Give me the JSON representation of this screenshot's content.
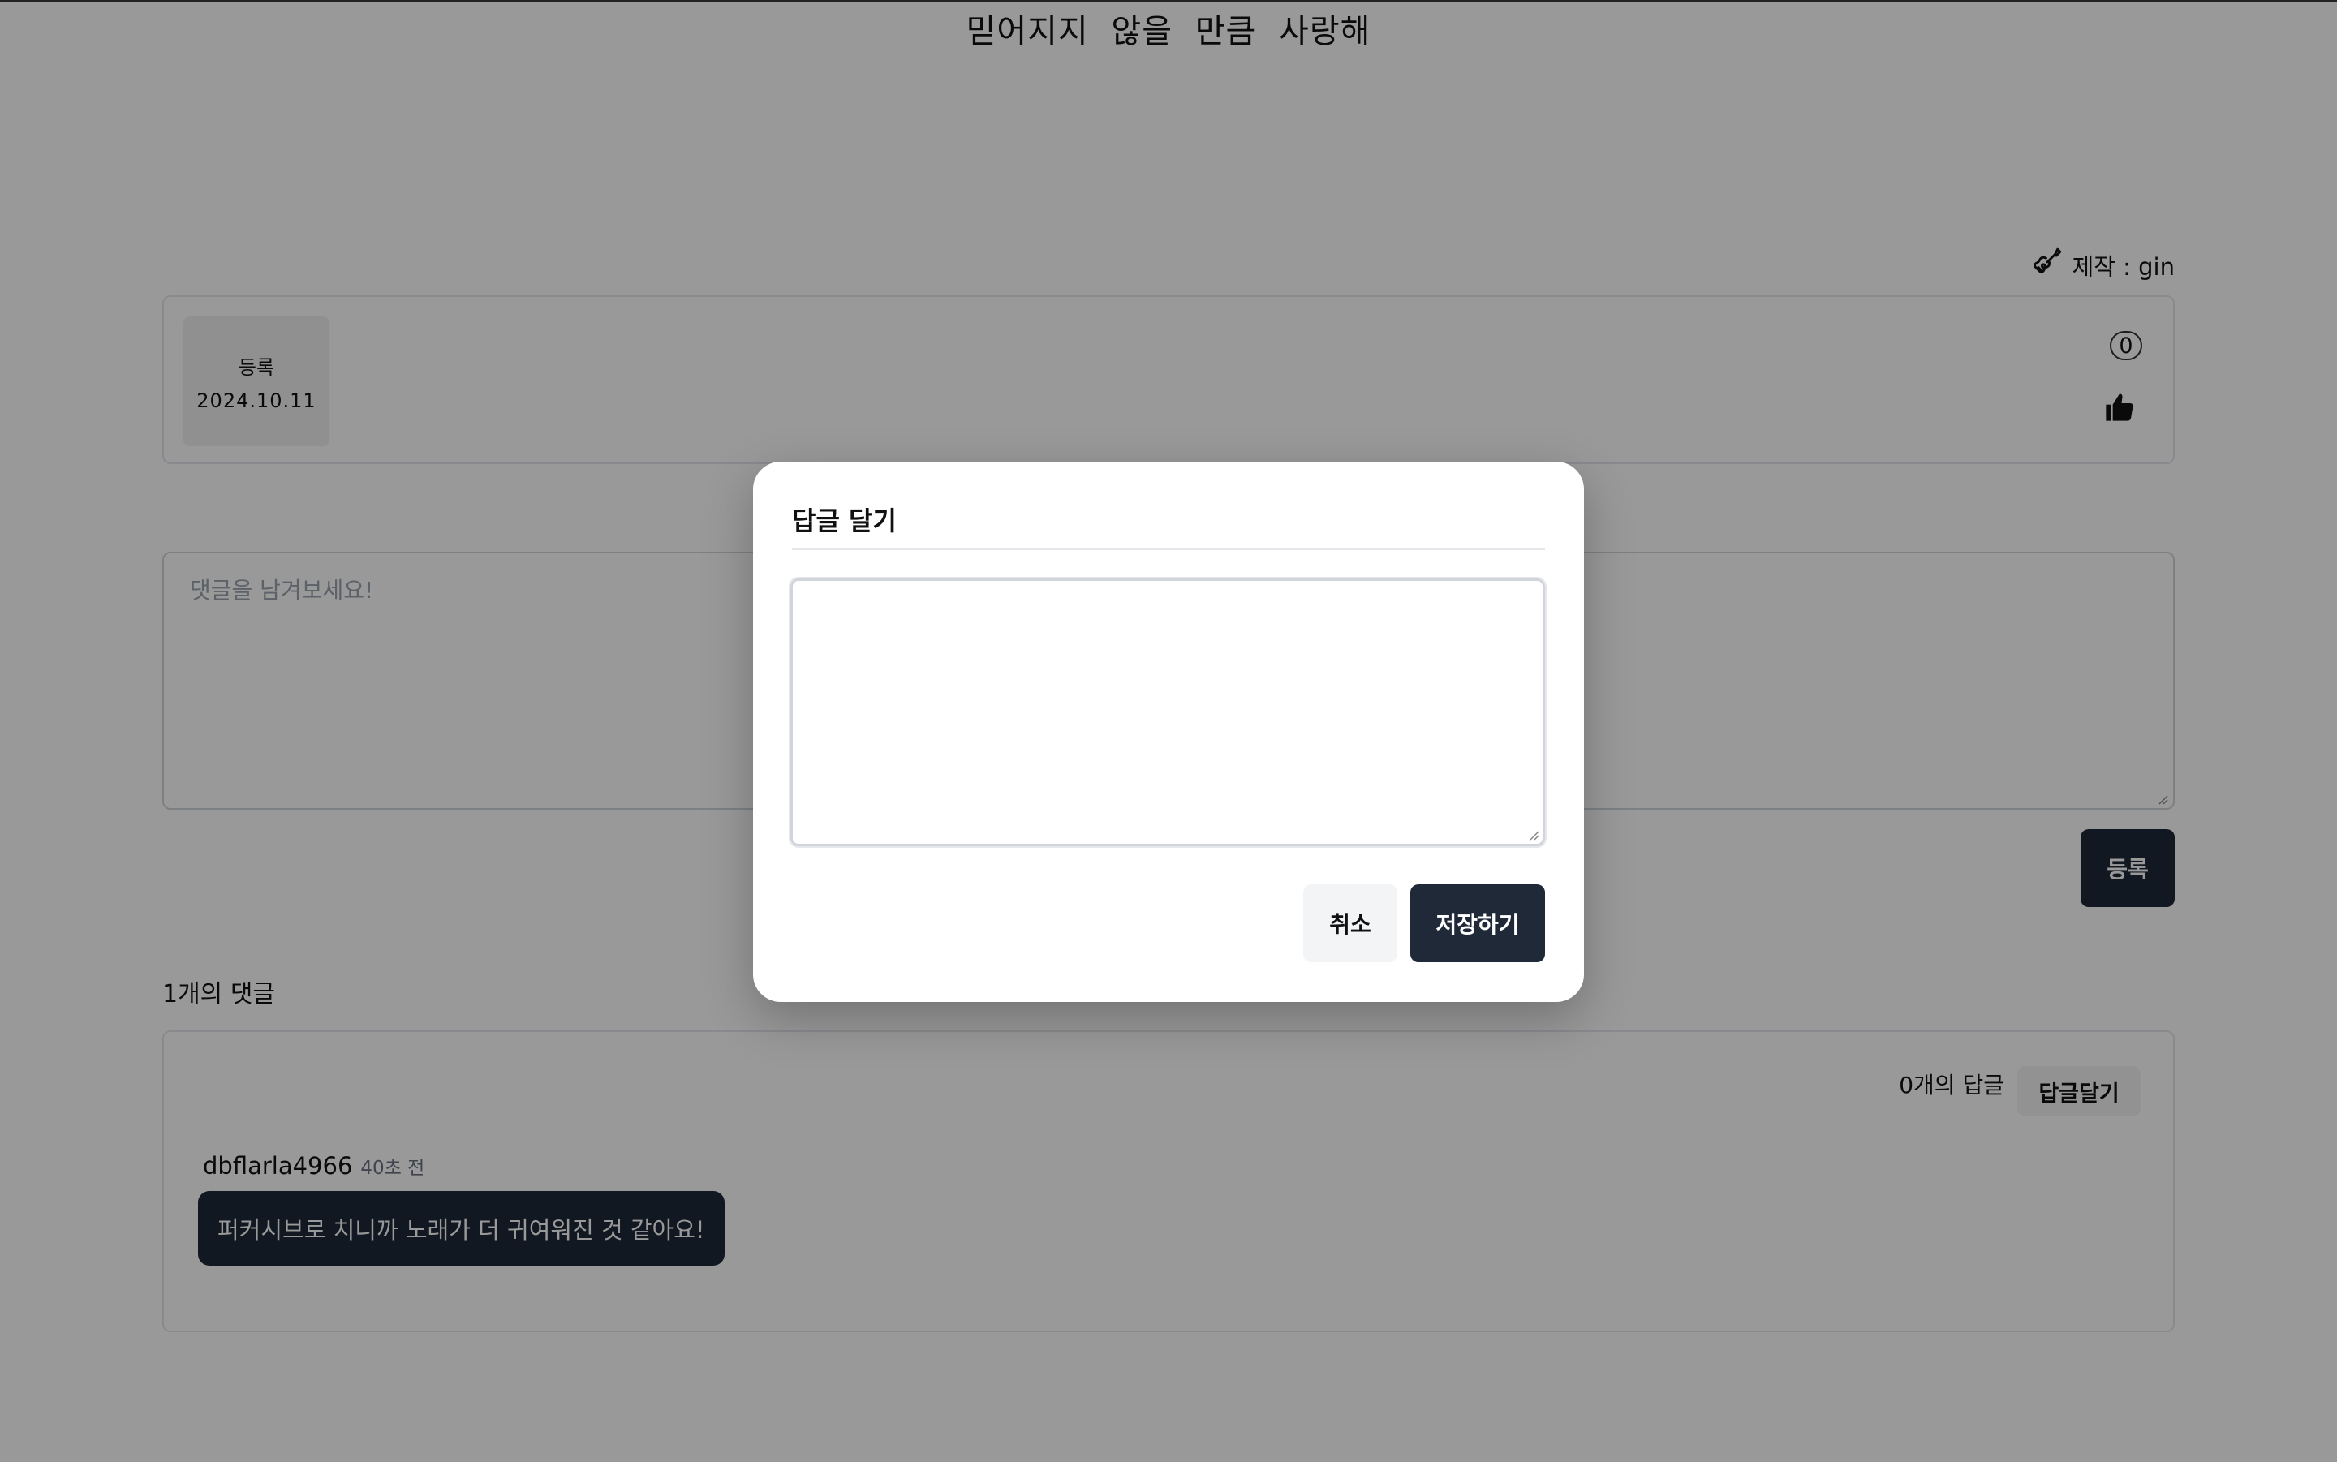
{
  "header": {
    "song_title": "믿어지지 않을 만큼 사랑해",
    "credit": "제작 : gin"
  },
  "song_info": {
    "date_label": "등록",
    "date_value": "2024.10.11",
    "like_count": "0"
  },
  "comment_form": {
    "placeholder": "댓글을 남겨보세요!",
    "submit_label": "등록"
  },
  "comments": {
    "count_title": "1개의 댓글",
    "items": [
      {
        "author": "dbflarla4966",
        "time_ago": "40초 전",
        "text": "퍼커시브로 치니까 노래가 더 귀여워진 것 같아요!",
        "reply_count": "0개의 답글",
        "reply_button": "답글달기"
      }
    ]
  },
  "reply_modal": {
    "title": "답글 달기",
    "input_value": "",
    "cancel_label": "취소",
    "save_label": "저장하기"
  },
  "colors": {
    "primary_dark": "#1f2937",
    "overlay": "rgba(0,0,0,0.4)"
  },
  "icons": {
    "credit": "guitar-icon",
    "like": "thumbs-up-icon"
  }
}
